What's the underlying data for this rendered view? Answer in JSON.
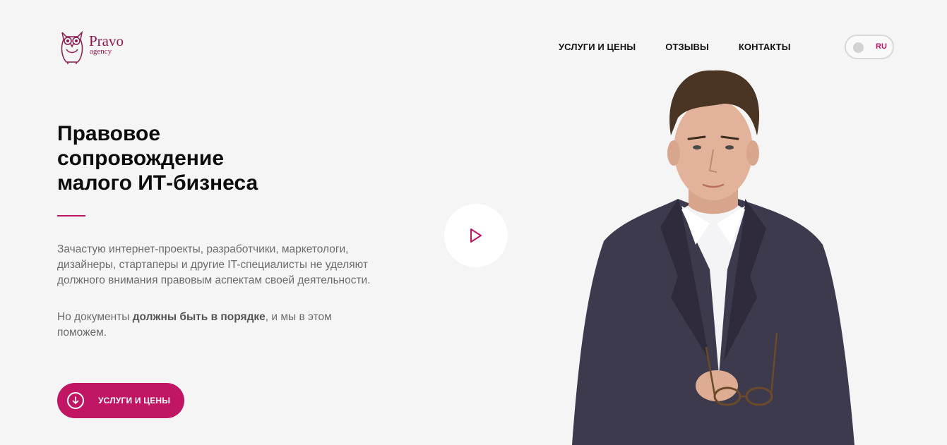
{
  "brand": {
    "name": "Pravo",
    "sub": "agency",
    "color": "#8b1a4f"
  },
  "nav": {
    "items": [
      {
        "label": "УСЛУГИ И ЦЕНЫ"
      },
      {
        "label": "ОТЗЫВЫ"
      },
      {
        "label": "КОНТАКТЫ"
      }
    ]
  },
  "lang": {
    "current": "RU"
  },
  "hero": {
    "title_line1": "Правовое",
    "title_line2": "сопровождение",
    "title_line3": "малого ИТ-бизнеса",
    "paragraph1": "Зачастую интернет-проекты, разработчики, маркетологи, дизайнеры, стартаперы и другие IT-специалисты не уделяют должного внимания правовым аспектам своей деятельности.",
    "paragraph2_pre": "Но документы ",
    "paragraph2_bold": "должны быть в порядке",
    "paragraph2_post": ", и мы в этом поможем.",
    "cta_label": "УСЛУГИ И ЦЕНЫ"
  },
  "icons": {
    "logo": "owl-logo-icon",
    "play": "play-icon",
    "cta": "arrow-down-circle-icon"
  },
  "colors": {
    "accent": "#c01663",
    "background": "#f5f5f5"
  }
}
